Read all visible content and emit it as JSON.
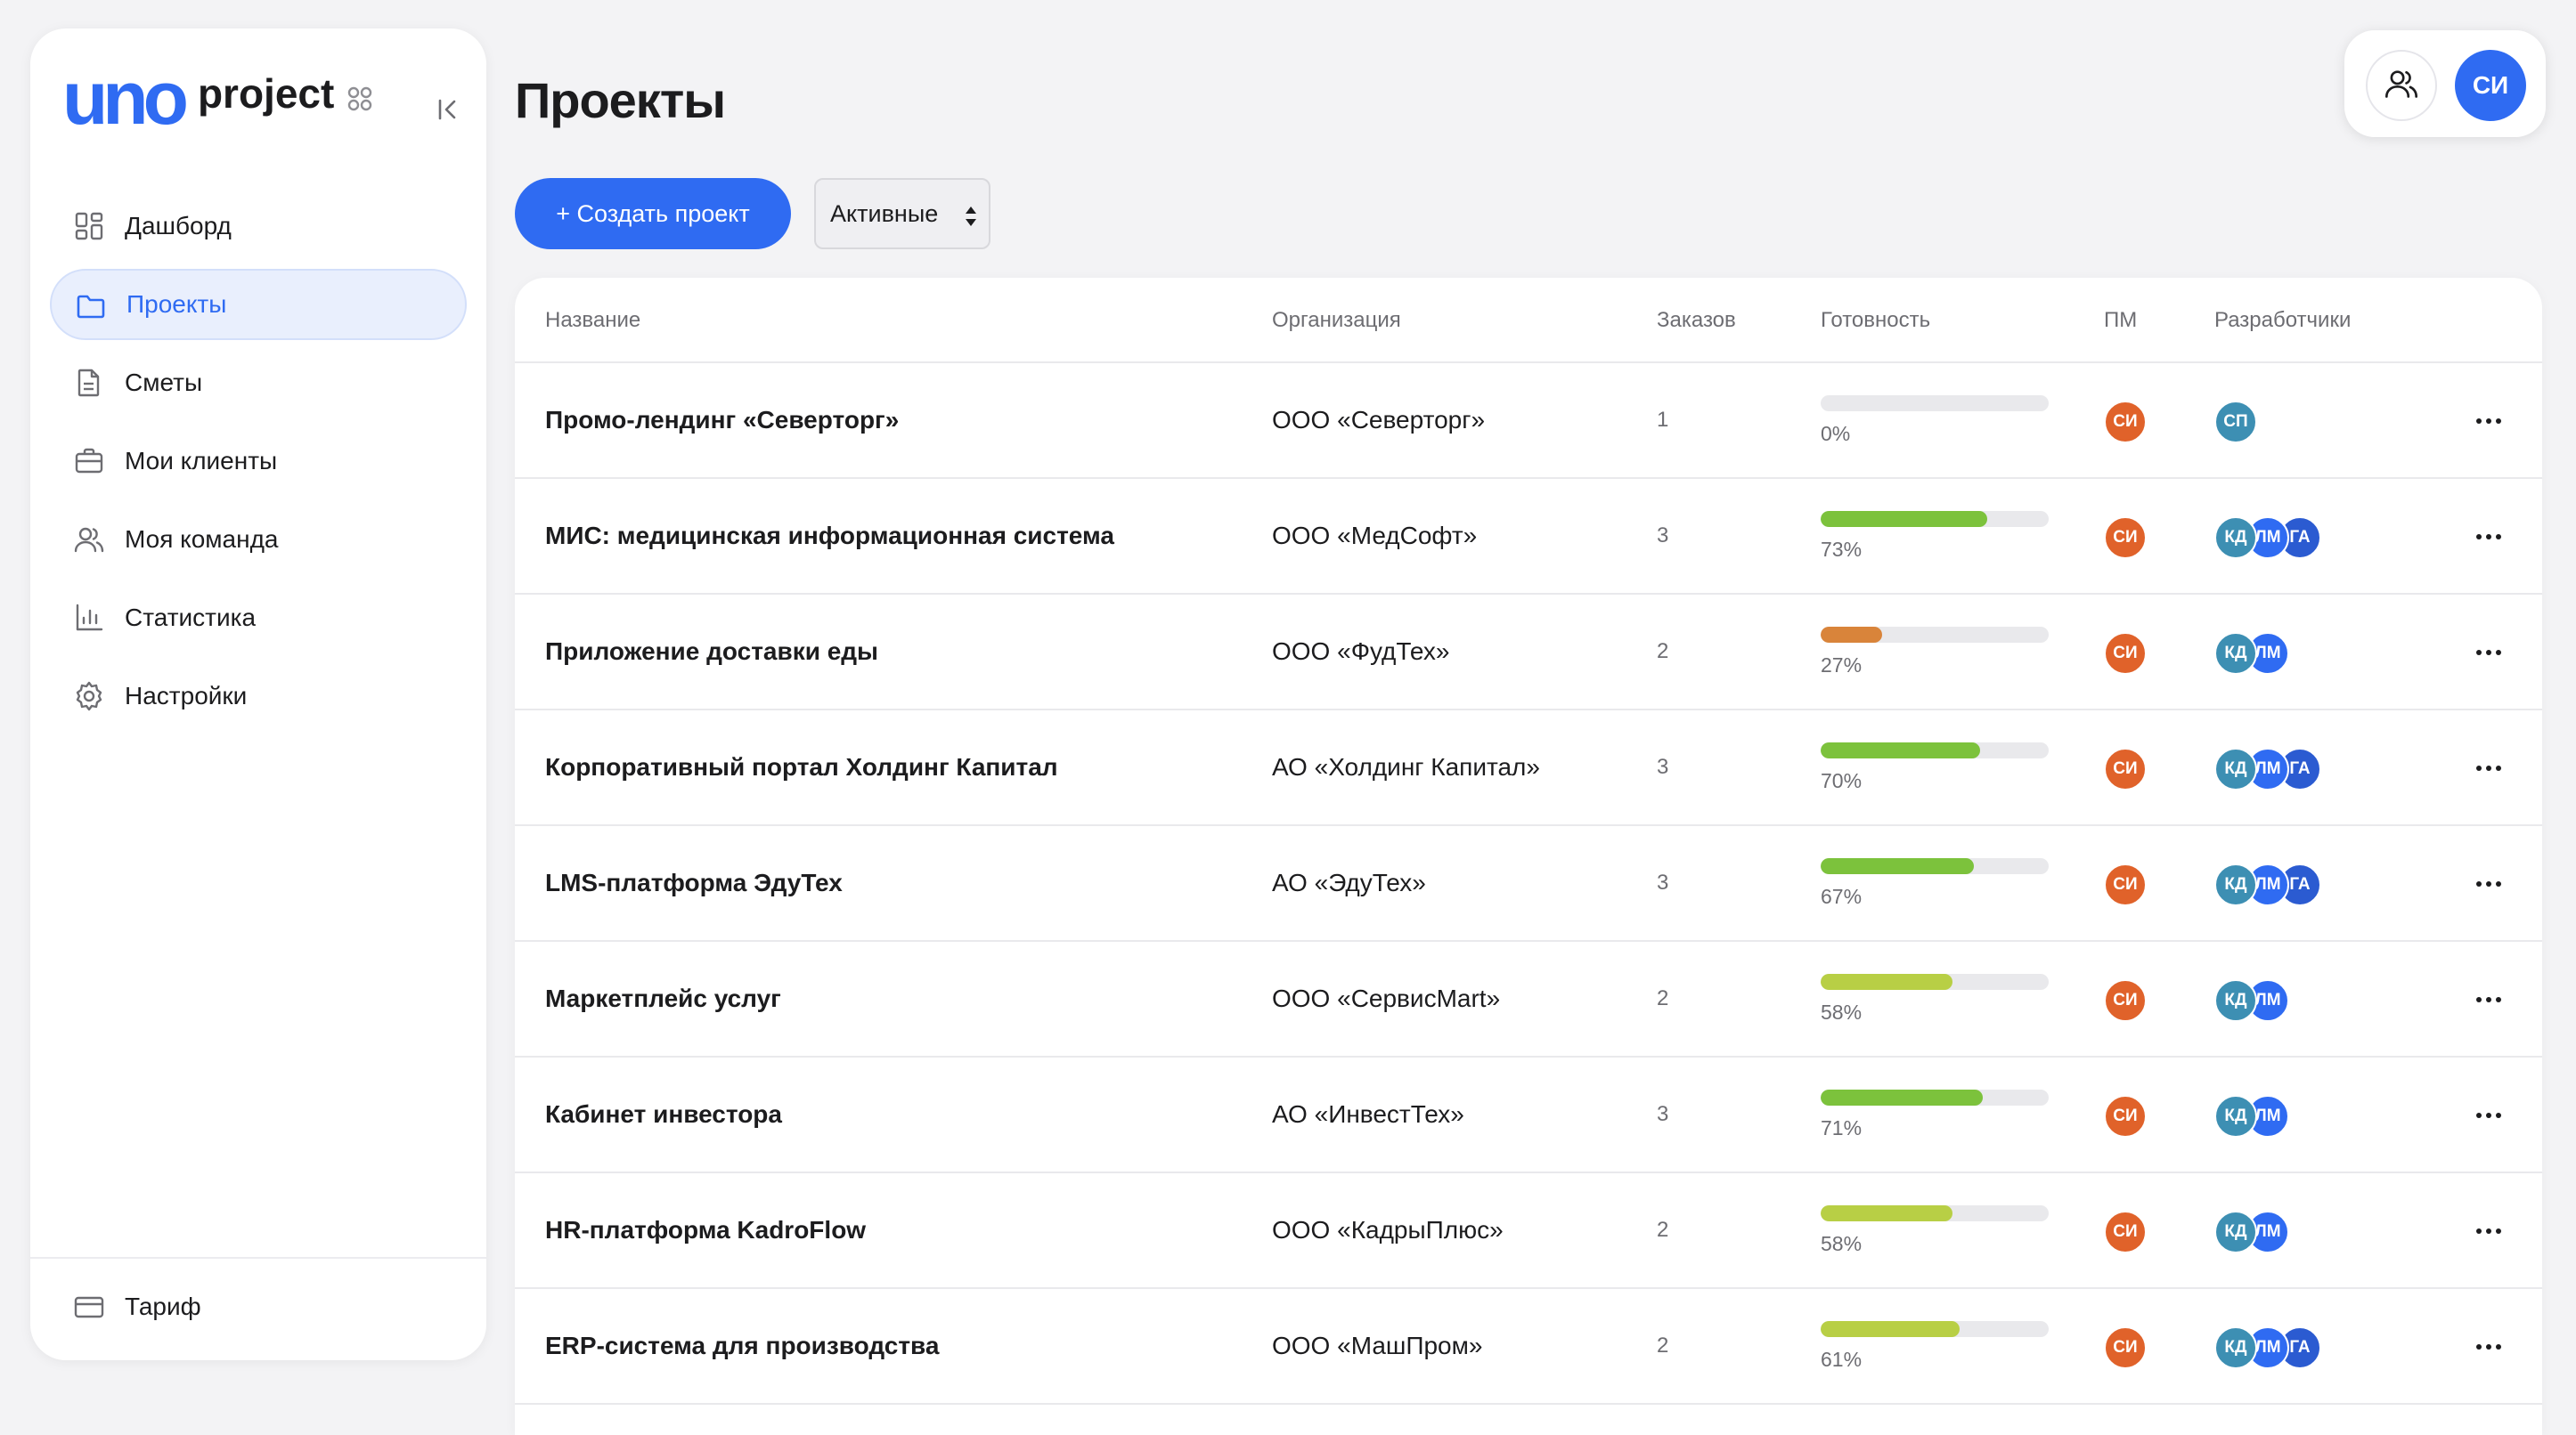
{
  "brand": {
    "logo_text": "uno",
    "product": "project"
  },
  "sidebar": {
    "items": [
      {
        "id": "dashboard",
        "label": "Дашборд",
        "icon": "dashboard-icon",
        "active": false
      },
      {
        "id": "projects",
        "label": "Проекты",
        "icon": "folder-icon",
        "active": true
      },
      {
        "id": "estimates",
        "label": "Сметы",
        "icon": "document-icon",
        "active": false
      },
      {
        "id": "clients",
        "label": "Мои клиенты",
        "icon": "briefcase-icon",
        "active": false
      },
      {
        "id": "team",
        "label": "Моя команда",
        "icon": "users-icon",
        "active": false
      },
      {
        "id": "stats",
        "label": "Статистика",
        "icon": "bar-chart-icon",
        "active": false
      },
      {
        "id": "settings",
        "label": "Настройки",
        "icon": "gear-icon",
        "active": false
      }
    ],
    "tariff_label": "Тариф"
  },
  "header": {
    "title": "Проекты",
    "user_initials": "СИ"
  },
  "toolbar": {
    "create_label": "+ Создать проект",
    "filter_value": "Активные"
  },
  "table": {
    "columns": [
      "Название",
      "Организация",
      "Заказов",
      "Готовность",
      "ПМ",
      "Разработчики"
    ],
    "rows": [
      {
        "name": "Промо-лендинг «Северторг»",
        "org": "ООО «Северторг»",
        "orders": "1",
        "progress": 0,
        "progress_label": "0%",
        "pm": "СИ",
        "devs": [
          "СП"
        ]
      },
      {
        "name": "МИС: медицинская информационная система",
        "org": "ООО «МедСофт»",
        "orders": "3",
        "progress": 73,
        "progress_label": "73%",
        "pm": "СИ",
        "devs": [
          "КД",
          "ЛМ",
          "ГА"
        ]
      },
      {
        "name": "Приложение доставки еды",
        "org": "ООО «ФудТех»",
        "orders": "2",
        "progress": 27,
        "progress_label": "27%",
        "pm": "СИ",
        "devs": [
          "КД",
          "ЛМ"
        ]
      },
      {
        "name": "Корпоративный портал Холдинг Капитал",
        "org": "АО «Холдинг Капитал»",
        "orders": "3",
        "progress": 70,
        "progress_label": "70%",
        "pm": "СИ",
        "devs": [
          "КД",
          "ЛМ",
          "ГА"
        ]
      },
      {
        "name": "LMS-платформа ЭдуТех",
        "org": "АО «ЭдуТех»",
        "orders": "3",
        "progress": 67,
        "progress_label": "67%",
        "pm": "СИ",
        "devs": [
          "КД",
          "ЛМ",
          "ГА"
        ]
      },
      {
        "name": "Маркетплейс услуг",
        "org": "ООО «СервисMart»",
        "orders": "2",
        "progress": 58,
        "progress_label": "58%",
        "pm": "СИ",
        "devs": [
          "КД",
          "ЛМ"
        ]
      },
      {
        "name": "Кабинет инвестора",
        "org": "АО «ИнвестТех»",
        "orders": "3",
        "progress": 71,
        "progress_label": "71%",
        "pm": "СИ",
        "devs": [
          "КД",
          "ЛМ"
        ]
      },
      {
        "name": "HR-платформа KadroFlow",
        "org": "ООО «КадрыПлюс»",
        "orders": "2",
        "progress": 58,
        "progress_label": "58%",
        "pm": "СИ",
        "devs": [
          "КД",
          "ЛМ"
        ]
      },
      {
        "name": "ERP-система для производства",
        "org": "ООО «МашПром»",
        "orders": "2",
        "progress": 61,
        "progress_label": "61%",
        "pm": "СИ",
        "devs": [
          "КД",
          "ЛМ",
          "ГА"
        ]
      }
    ]
  },
  "colors": {
    "accent": "#2f6bf2",
    "pm_avatar": "#e0622a",
    "progress_high": "#7cc23c",
    "progress_mid": "#b8cf45",
    "progress_low": "#d9843a",
    "dev_colors": {
      "СП": "#3d8fb3",
      "КД": "#3d8fb3",
      "ЛМ": "#2f6bf2",
      "ГА": "#2b5bd1"
    }
  }
}
